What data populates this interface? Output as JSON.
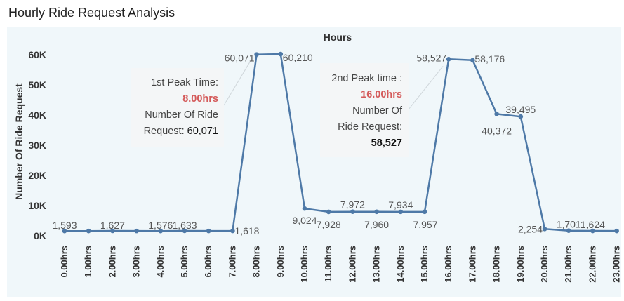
{
  "title": "Hourly Ride Request Analysis",
  "chart_data": {
    "type": "line",
    "axis_title_top": "Hours",
    "ylabel": "Number Of Ride Request",
    "ylim": [
      0,
      62000
    ],
    "yticks": [
      0,
      10000,
      20000,
      30000,
      40000,
      50000,
      60000
    ],
    "ytick_labels": [
      "0K",
      "10K",
      "20K",
      "30K",
      "40K",
      "50K",
      "60K"
    ],
    "categories": [
      "0.00hrs",
      "1.00hrs",
      "2.00hrs",
      "3.00hrs",
      "4.00hrs",
      "5.00hrs",
      "6.00hrs",
      "7.00hrs",
      "8.00hrs",
      "9.00hrs",
      "10.00hrs",
      "11.00hrs",
      "12.00hrs",
      "13.00hrs",
      "14.00hrs",
      "15.00hrs",
      "16.00hrs",
      "17.00hrs",
      "18.00hrs",
      "19.00hrs",
      "20.00hrs",
      "21.00hrs",
      "22.00hrs",
      "23.00hrs"
    ],
    "values": [
      null,
      null,
      null,
      null,
      null,
      null,
      null,
      null,
      60071,
      60210,
      9024,
      7928,
      7972,
      7960,
      7934,
      7957,
      58527,
      58176,
      40372,
      39495,
      2254,
      1701,
      1624,
      null
    ],
    "series": [
      {
        "values": [
          1593,
          1590,
          1627,
          1600,
          1576,
          1633,
          1600,
          1618,
          60071,
          60210,
          9024,
          7928,
          7972,
          7960,
          7934,
          7957,
          58527,
          58176,
          40372,
          39495,
          2254,
          1701,
          1624,
          1600
        ],
        "labels": [
          "1,593",
          "",
          "1,627",
          "",
          "1,576",
          "1,633",
          "",
          "1,618",
          "60,071",
          "60,210",
          "9,024",
          "7,928",
          "7,972",
          "7,960",
          "7,934",
          "7,957",
          "58,527",
          "58,176",
          "40,372",
          "39,495",
          "2,254",
          "1,701",
          "1,624",
          ""
        ]
      }
    ],
    "grid": false,
    "line_color": "#4e79a7",
    "annotations": [
      {
        "line1": "1st Peak Time:",
        "time": "8.00hrs",
        "line3": "Number Of Ride",
        "line4_prefix": "Request: ",
        "line4_value": "60,071"
      },
      {
        "line1": "2nd Peak time :",
        "time": "16.00hrs",
        "line3": "Number Of",
        "line4": "Ride Request:",
        "value": "58,527"
      }
    ],
    "highlight_color": "#d45a5a"
  }
}
